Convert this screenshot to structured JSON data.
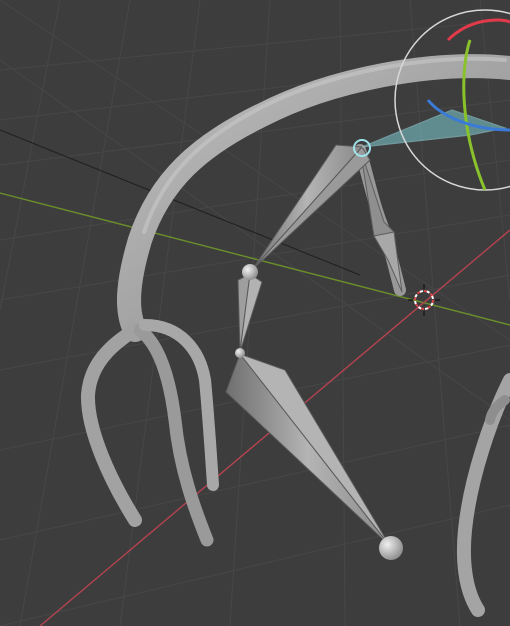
{
  "app": {
    "view": "3d-viewport",
    "mode": "pose"
  },
  "colors": {
    "background": "#3d3d3d",
    "grid_line": "#474747",
    "x_axis": "#b4434f",
    "y_axis": "#6b8e2a",
    "mesh": "#a6a6a6",
    "bone": "#9c9c9c",
    "bone_active": "#7ecdd4",
    "gizmo_ring": "#d8d8d8",
    "gizmo_x": "#e23a4a",
    "gizmo_y": "#8ac22c",
    "gizmo_z": "#3a7bd8",
    "cursor_red": "#d8454a",
    "cursor_white": "#ffffff"
  },
  "objects": {
    "mesh_name": "antler-mesh",
    "bones": [
      "bone-upper",
      "bone-middle",
      "bone-lower",
      "bone-branch"
    ],
    "active_bone": "bone-branch"
  },
  "icons": {
    "cursor": "3d-cursor-icon",
    "rotate_gizmo": "rotate-gizmo-icon"
  }
}
